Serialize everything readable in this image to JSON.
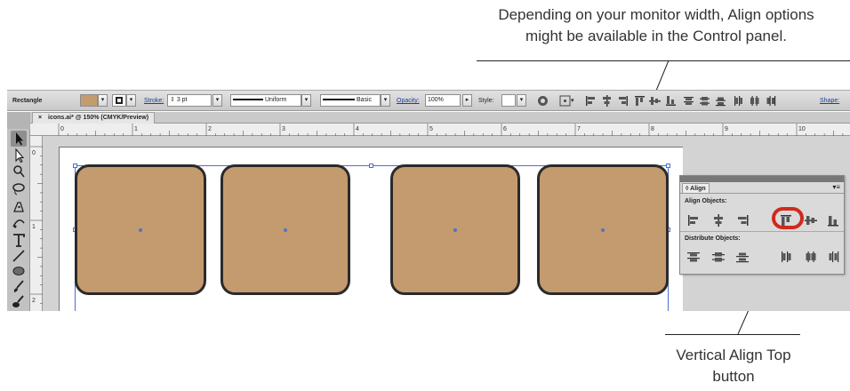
{
  "callouts": {
    "top_line1": "Depending on your monitor width, Align options",
    "top_line2": "might be available in the Control panel.",
    "bottom_line1": "Vertical Align Top",
    "bottom_line2": "button"
  },
  "control_panel": {
    "object_type": "Rectangle",
    "fill_color": "#c49b6e",
    "stroke_label": "Stroke:",
    "stroke_weight": "3 pt",
    "profile_label": "Uniform",
    "brush_label": "Basic",
    "opacity_label": "Opacity:",
    "opacity_value": "100%",
    "style_label": "Style:",
    "shape_label": "Shape:"
  },
  "document": {
    "tab_title": "icons.ai* @ 150% (CMYK/Preview)",
    "close_glyph": "×"
  },
  "rulers": {
    "horizontal": [
      "0",
      "1",
      "2",
      "3",
      "4",
      "5",
      "6",
      "7",
      "8",
      "9",
      "10"
    ],
    "vertical": [
      "0",
      "1",
      "2"
    ]
  },
  "artwork": {
    "icon_fill": "#c49b6e",
    "stroke_color": "#2a2a2a",
    "selection_color": "#4d6fd0",
    "icons": [
      "icon-1",
      "icon-2",
      "icon-3",
      "icon-4"
    ]
  },
  "align_panel": {
    "tab_title": "◊ Align",
    "menu_glyph": "▾≡",
    "align_objects_label": "Align Objects:",
    "distribute_objects_label": "Distribute Objects:",
    "highlight_color": "#d02a1c"
  }
}
